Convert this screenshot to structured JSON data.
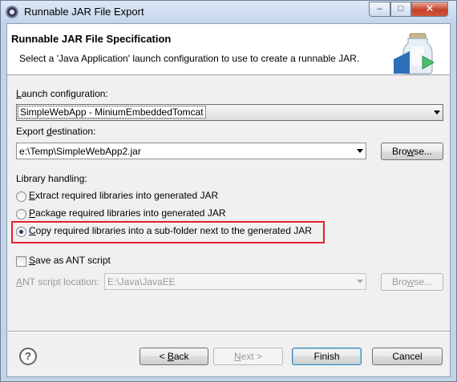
{
  "window": {
    "title": "Runnable JAR File Export",
    "controls": {
      "minimize": "–",
      "maximize": "□",
      "close": "✕"
    }
  },
  "banner": {
    "title": "Runnable JAR File Specification",
    "description": "Select a 'Java Application' launch configuration to use to create a runnable JAR.",
    "icon": "jar-export-icon"
  },
  "launch": {
    "label_key": "L",
    "label_rest": "aunch configuration:",
    "value": "SimpleWebApp - MiniumEmbeddedTomcat"
  },
  "export": {
    "label_pre": "Export ",
    "label_key": "d",
    "label_rest": "estination:",
    "value": "e:\\Temp\\SimpleWebApp2.jar",
    "browse_key": "w",
    "browse_pre": "Bro",
    "browse_rest": "se..."
  },
  "library": {
    "label": "Library handling:",
    "options": [
      {
        "key": "E",
        "rest": "xtract required libraries into generated JAR",
        "checked": false
      },
      {
        "key": "P",
        "rest": "ackage required libraries into generated JAR",
        "checked": false
      },
      {
        "key": "C",
        "rest": "opy required libraries into a sub-folder next to the generated JAR",
        "checked": true
      }
    ],
    "highlight_color": "#e0202a"
  },
  "ant": {
    "checkbox_key": "S",
    "checkbox_rest": "ave as ANT script",
    "checked": false,
    "location_key": "A",
    "location_rest": "NT script location:",
    "location_value": "E:\\Java\\JavaEE",
    "browse_pre": "Bro",
    "browse_key": "w",
    "browse_rest": "se..."
  },
  "footer": {
    "help": "?",
    "back_pre": "< ",
    "back_key": "B",
    "back_rest": "ack",
    "next_key": "N",
    "next_rest": "ext >",
    "finish": "Finish",
    "cancel": "Cancel"
  }
}
